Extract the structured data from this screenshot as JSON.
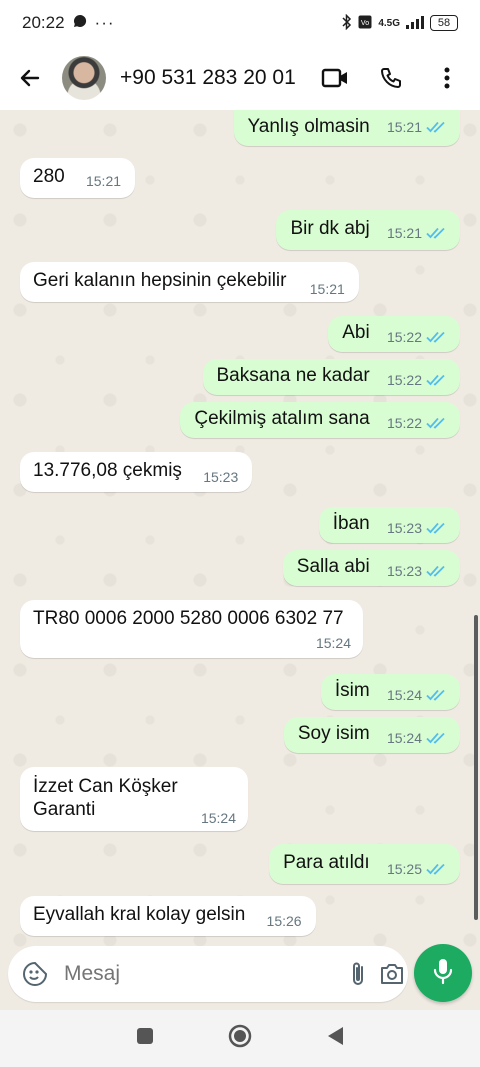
{
  "status_bar": {
    "time": "20:22",
    "network": "4.5G",
    "battery": "58"
  },
  "header": {
    "contact_name": "+90 531 283 20 01",
    "icons": [
      "back-arrow-icon",
      "avatar",
      "video-call-icon",
      "phone-icon",
      "more-icon"
    ]
  },
  "messages": [
    {
      "dir": "out",
      "text": "Yanlış olmasin",
      "time": "15:21",
      "read": true
    },
    {
      "dir": "in",
      "text": "280",
      "time": "15:21"
    },
    {
      "dir": "out",
      "text": "Bir dk abj",
      "time": "15:21",
      "read": true
    },
    {
      "dir": "in",
      "text": "Geri kalanın hepsinin çekebilir",
      "time": "15:21"
    },
    {
      "dir": "out",
      "text": "Abi",
      "time": "15:22",
      "read": true
    },
    {
      "dir": "out",
      "text": "Baksana ne kadar",
      "time": "15:22",
      "read": true
    },
    {
      "dir": "out",
      "text": "Çekilmiş atalım sana",
      "time": "15:22",
      "read": true
    },
    {
      "dir": "in",
      "text": "13.776,08 çekmiş",
      "time": "15:23"
    },
    {
      "dir": "out",
      "text": "İban",
      "time": "15:23",
      "read": true
    },
    {
      "dir": "out",
      "text": "Salla abi",
      "time": "15:23",
      "read": true
    },
    {
      "dir": "in",
      "text": "TR80 0006 2000 5280 0006 6302 77",
      "time": "15:24"
    },
    {
      "dir": "out",
      "text": "İsim",
      "time": "15:24",
      "read": true
    },
    {
      "dir": "out",
      "text": "Soy isim",
      "time": "15:24",
      "read": true
    },
    {
      "dir": "in",
      "text_lines": [
        "İzzet Can Köşker",
        "Garanti"
      ],
      "time": "15:24"
    },
    {
      "dir": "out",
      "text": "Para atıldı",
      "time": "15:25",
      "read": true
    },
    {
      "dir": "in",
      "text": "Eyvallah kral kolay gelsin",
      "time": "15:26"
    }
  ],
  "composer": {
    "placeholder": "Mesaj"
  },
  "colors": {
    "chat_bg": "#efeae2",
    "outgoing_bubble": "#d9fdd3",
    "incoming_bubble": "#ffffff",
    "read_ticks": "#53bdeb",
    "mic_button": "#1daa61"
  }
}
